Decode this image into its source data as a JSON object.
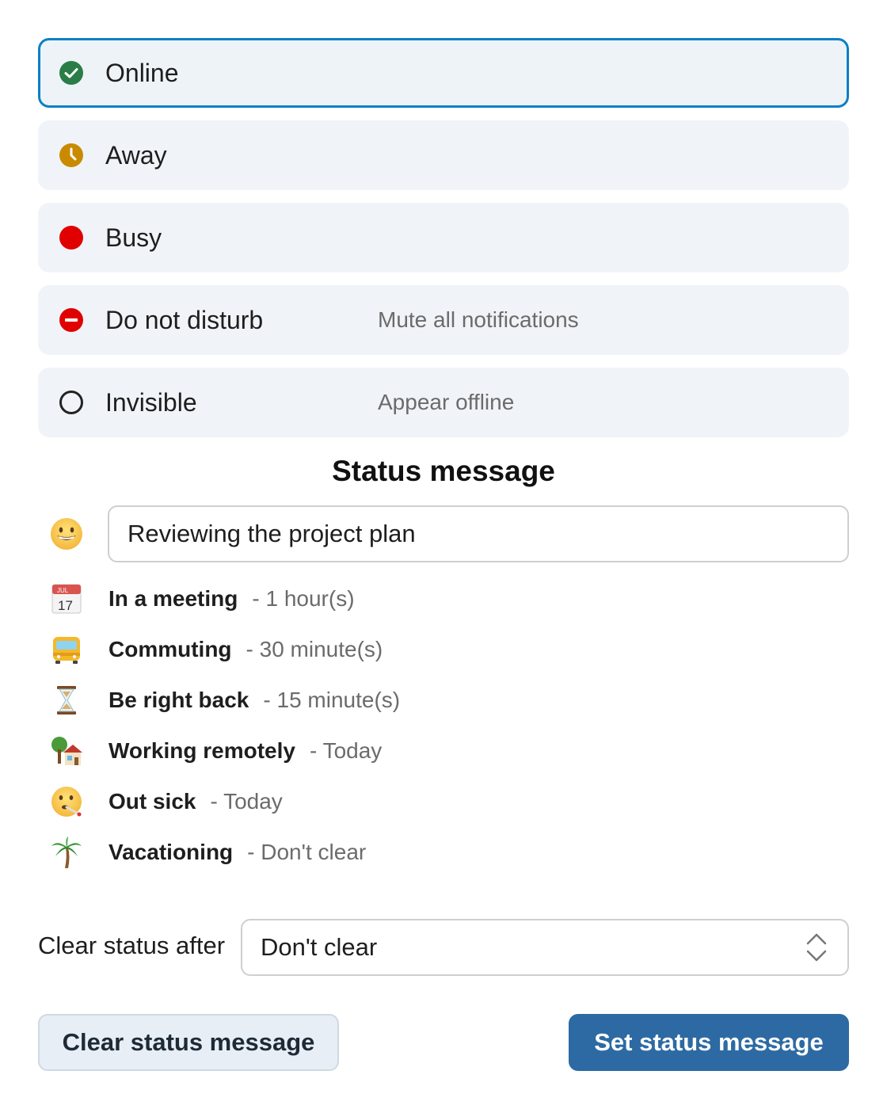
{
  "statuses": [
    {
      "label": "Online",
      "sub": "",
      "icon": "check-circle-icon",
      "color": "#2a7d46",
      "selected": true
    },
    {
      "label": "Away",
      "sub": "",
      "icon": "clock-icon",
      "color": "#c98a00",
      "selected": false
    },
    {
      "label": "Busy",
      "sub": "",
      "icon": "red-dot-icon",
      "color": "#e00000",
      "selected": false
    },
    {
      "label": "Do not disturb",
      "sub": "Mute all notifications",
      "icon": "minus-circle-icon",
      "color": "#e00000",
      "selected": false
    },
    {
      "label": "Invisible",
      "sub": "Appear offline",
      "icon": "empty-circle-icon",
      "color": "#222222",
      "selected": false
    }
  ],
  "status_message": {
    "heading": "Status message",
    "emoji": "grinning-face-emoji",
    "value": "Reviewing the project plan"
  },
  "presets": [
    {
      "name": "In a meeting",
      "duration": "- 1 hour(s)",
      "icon": "calendar-emoji"
    },
    {
      "name": "Commuting",
      "duration": "- 30 minute(s)",
      "icon": "bus-emoji"
    },
    {
      "name": "Be right back",
      "duration": "- 15 minute(s)",
      "icon": "hourglass-emoji"
    },
    {
      "name": "Working remotely",
      "duration": "- Today",
      "icon": "house-tree-emoji"
    },
    {
      "name": "Out sick",
      "duration": "- Today",
      "icon": "thermometer-face-emoji"
    },
    {
      "name": "Vacationing",
      "duration": "- Don't clear",
      "icon": "palm-tree-emoji"
    }
  ],
  "calendar_icon_text": {
    "month": "JUL",
    "day": "17"
  },
  "clear_after": {
    "label": "Clear status after",
    "value": "Don't clear"
  },
  "buttons": {
    "clear": "Clear status message",
    "set": "Set status message"
  },
  "colors": {
    "accent": "#0a80c4",
    "primary_button": "#2d6aa3",
    "option_bg": "#f0f4f8"
  }
}
